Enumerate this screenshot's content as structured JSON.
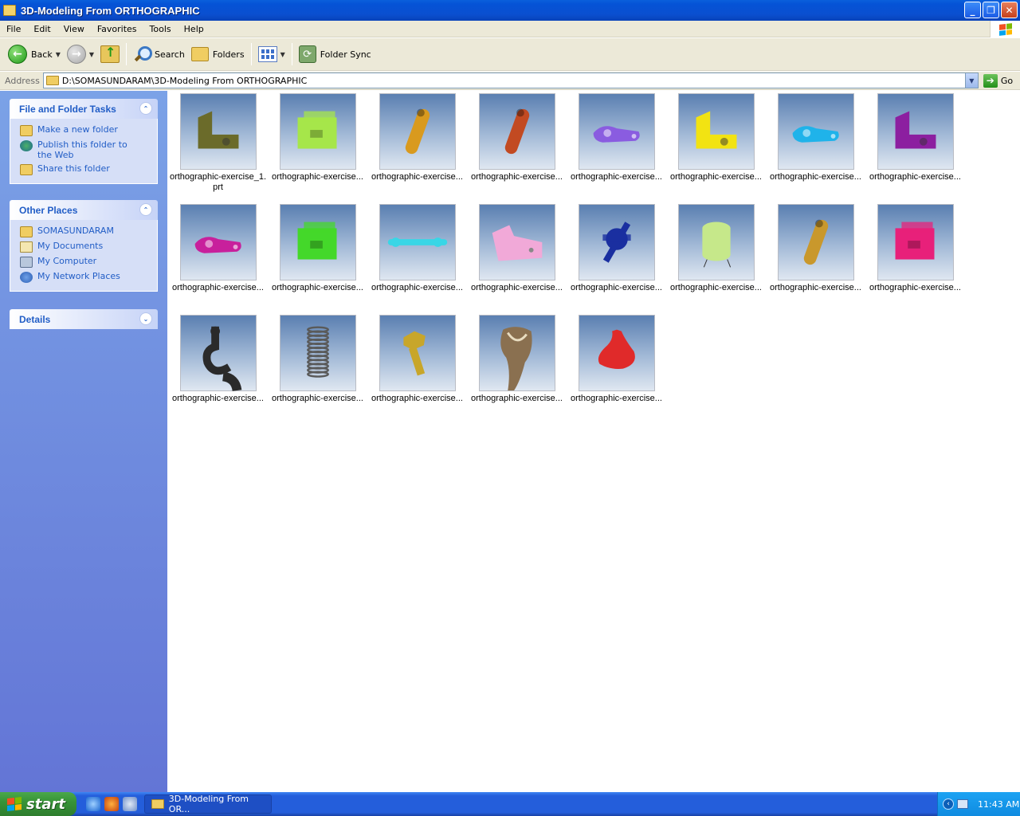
{
  "window": {
    "title": "3D-Modeling From ORTHOGRAPHIC",
    "controls": {
      "minimize": "_",
      "maximize": "❐",
      "close": "✕"
    }
  },
  "menu": [
    "File",
    "Edit",
    "View",
    "Favorites",
    "Tools",
    "Help"
  ],
  "toolbar": {
    "back_label": "Back",
    "search_label": "Search",
    "folders_label": "Folders",
    "sync_label": "Folder Sync"
  },
  "address": {
    "label": "Address",
    "path": "D:\\SOMASUNDARAM\\3D-Modeling From ORTHOGRAPHIC",
    "go_label": "Go"
  },
  "left_pane": {
    "tasks": {
      "title": "File and Folder Tasks",
      "items": [
        {
          "label": "Make a new folder",
          "icon": "new-folder-icon"
        },
        {
          "label": "Publish this folder to the Web",
          "icon": "publish-web-icon"
        },
        {
          "label": "Share this folder",
          "icon": "share-folder-icon"
        }
      ]
    },
    "places": {
      "title": "Other Places",
      "items": [
        {
          "label": "SOMASUNDARAM",
          "icon": "folder-icon"
        },
        {
          "label": "My Documents",
          "icon": "my-documents-icon"
        },
        {
          "label": "My Computer",
          "icon": "my-computer-icon"
        },
        {
          "label": "My Network Places",
          "icon": "network-places-icon"
        }
      ]
    },
    "details": {
      "title": "Details"
    }
  },
  "files": [
    {
      "name": "orthographic-exercise_1.prt",
      "color": "#6b6b2a",
      "shape": "bracket"
    },
    {
      "name": "orthographic-exercise...",
      "color": "#a6e64a",
      "shape": "block"
    },
    {
      "name": "orthographic-exercise...",
      "color": "#d99a1e",
      "shape": "link"
    },
    {
      "name": "orthographic-exercise...",
      "color": "#c24a22",
      "shape": "link"
    },
    {
      "name": "orthographic-exercise...",
      "color": "#8a5ce0",
      "shape": "lever"
    },
    {
      "name": "orthographic-exercise...",
      "color": "#f2e312",
      "shape": "bracket"
    },
    {
      "name": "orthographic-exercise...",
      "color": "#1fb3ea",
      "shape": "lever"
    },
    {
      "name": "orthographic-exercise...",
      "color": "#8c1fa0",
      "shape": "bracket"
    },
    {
      "name": "orthographic-exercise...",
      "color": "#c8209c",
      "shape": "lever"
    },
    {
      "name": "orthographic-exercise...",
      "color": "#44d82a",
      "shape": "block"
    },
    {
      "name": "orthographic-exercise...",
      "color": "#39d6e6",
      "shape": "rod"
    },
    {
      "name": "orthographic-exercise...",
      "color": "#f1a9d8",
      "shape": "plate"
    },
    {
      "name": "orthographic-exercise...",
      "color": "#1a2fa0",
      "shape": "gear"
    },
    {
      "name": "orthographic-exercise...",
      "color": "#c6e88a",
      "shape": "cylinder"
    },
    {
      "name": "orthographic-exercise...",
      "color": "#c9982c",
      "shape": "link"
    },
    {
      "name": "orthographic-exercise...",
      "color": "#e8207a",
      "shape": "block"
    },
    {
      "name": "orthographic-exercise...",
      "color": "#2a2a2a",
      "shape": "hook"
    },
    {
      "name": "orthographic-exercise...",
      "color": "#5a5a5a",
      "shape": "spring"
    },
    {
      "name": "orthographic-exercise...",
      "color": "#c8a62a",
      "shape": "bolt"
    },
    {
      "name": "orthographic-exercise...",
      "color": "#8a7050",
      "shape": "twist"
    },
    {
      "name": "orthographic-exercise...",
      "color": "#e02a2a",
      "shape": "dome"
    }
  ],
  "taskbar": {
    "start_label": "start",
    "task_label": "3D-Modeling From OR...",
    "clock": "11:43 AM"
  }
}
